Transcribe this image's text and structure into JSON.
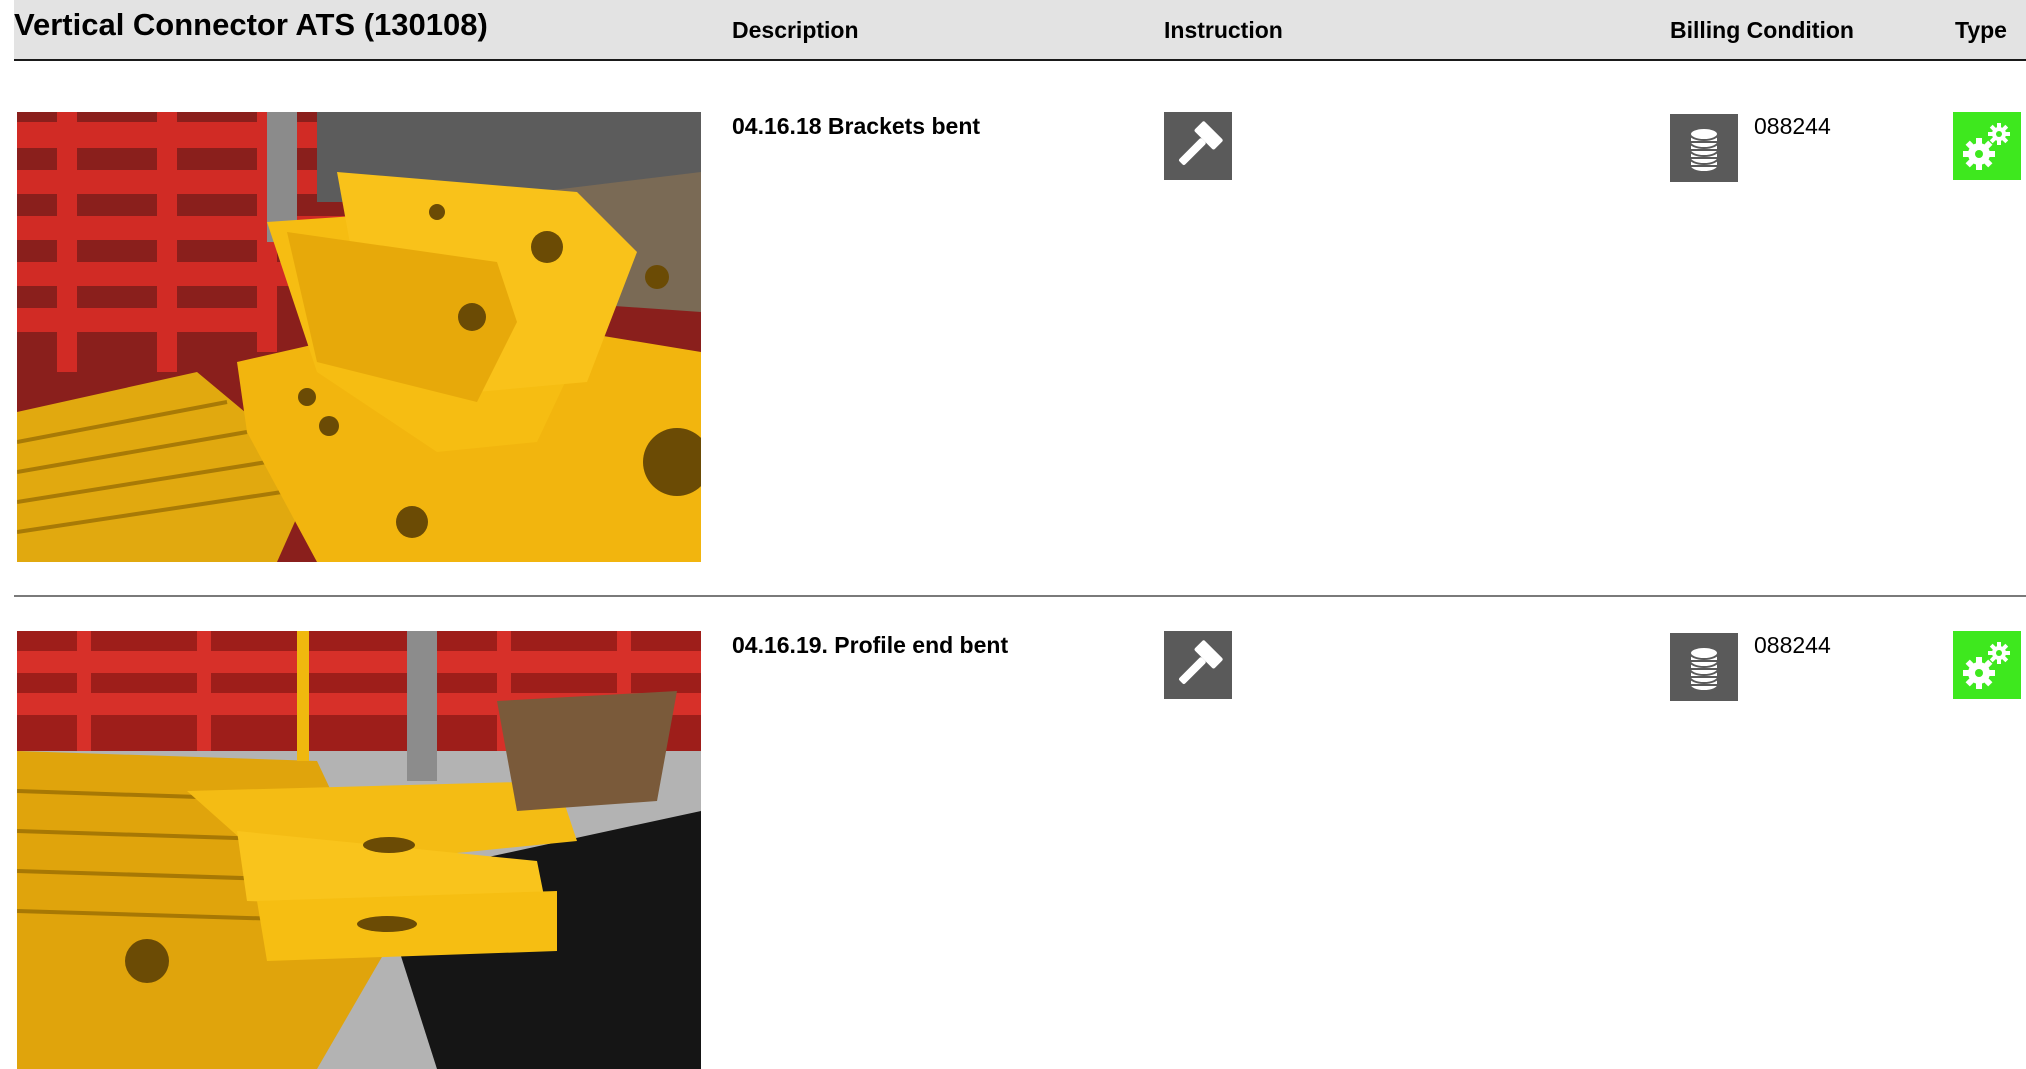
{
  "header": {
    "title": "Vertical Connector ATS (130108)",
    "columns": {
      "description": "Description",
      "instruction": "Instruction",
      "billing_condition": "Billing Condition",
      "type": "Type"
    }
  },
  "rows": [
    {
      "description": "04.16.18 Brackets bent",
      "instruction_icon": "hammer-icon",
      "billing_icon": "coin-stack-icon",
      "billing_code": "088244",
      "type_icon": "gears-icon"
    },
    {
      "description": "04.16.19. Profile end bent",
      "instruction_icon": "hammer-icon",
      "billing_icon": "coin-stack-icon",
      "billing_code": "088244",
      "type_icon": "gears-icon"
    }
  ],
  "colors": {
    "header_bg": "#e3e3e3",
    "icon_gray": "#5a5a5a",
    "type_green": "#3ee81e",
    "divider": "#7a7a7a"
  }
}
